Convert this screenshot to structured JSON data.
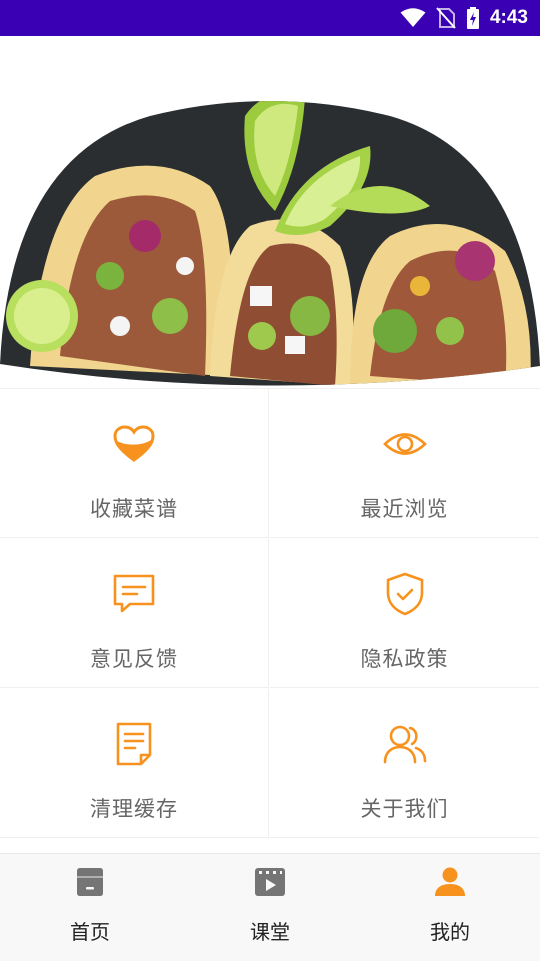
{
  "status_bar": {
    "time": "4:43",
    "background": "#3a00b3"
  },
  "hero": {
    "image": "tacos-with-lime-photo"
  },
  "menu": {
    "accent": "#f7921e",
    "items": [
      {
        "label": "收藏菜谱",
        "icon": "heart-bowl-icon"
      },
      {
        "label": "最近浏览",
        "icon": "eye-icon"
      },
      {
        "label": "意见反馈",
        "icon": "message-icon"
      },
      {
        "label": "隐私政策",
        "icon": "shield-check-icon"
      },
      {
        "label": "清理缓存",
        "icon": "document-icon"
      },
      {
        "label": "关于我们",
        "icon": "users-icon"
      }
    ]
  },
  "bottom_nav": {
    "active_color": "#f7921e",
    "inactive_color": "#757575",
    "items": [
      {
        "label": "首页",
        "icon": "store-icon",
        "active": false
      },
      {
        "label": "课堂",
        "icon": "video-icon",
        "active": false
      },
      {
        "label": "我的",
        "icon": "person-icon",
        "active": true
      }
    ]
  }
}
